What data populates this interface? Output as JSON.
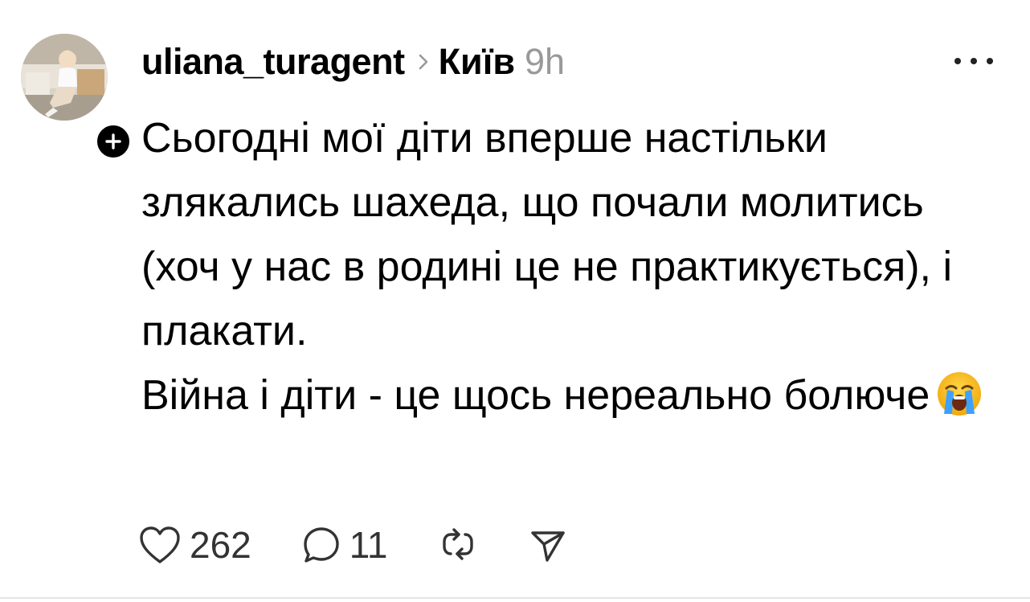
{
  "post": {
    "username": "uliana_turagent",
    "location": "Київ",
    "time": "9h",
    "text_paragraphs": [
      "Сьогодні мої діти вперше настільки злякались шахеда, що почали молитись (хоч у нас в родині це не практикується), і плакати.",
      "Війна і діти - це щось нереально болюче"
    ],
    "emoji": "loudly-crying-face",
    "likes": "262",
    "replies": "11"
  },
  "icons": {
    "follow": "plus-icon",
    "chevron": "chevron-right-icon",
    "more": "more-horizontal-icon",
    "like": "heart-icon",
    "reply": "comment-icon",
    "repost": "repost-icon",
    "share": "send-icon"
  },
  "colors": {
    "text": "#000000",
    "muted": "#999999",
    "count": "#333333",
    "divider": "#e5e5e5"
  }
}
